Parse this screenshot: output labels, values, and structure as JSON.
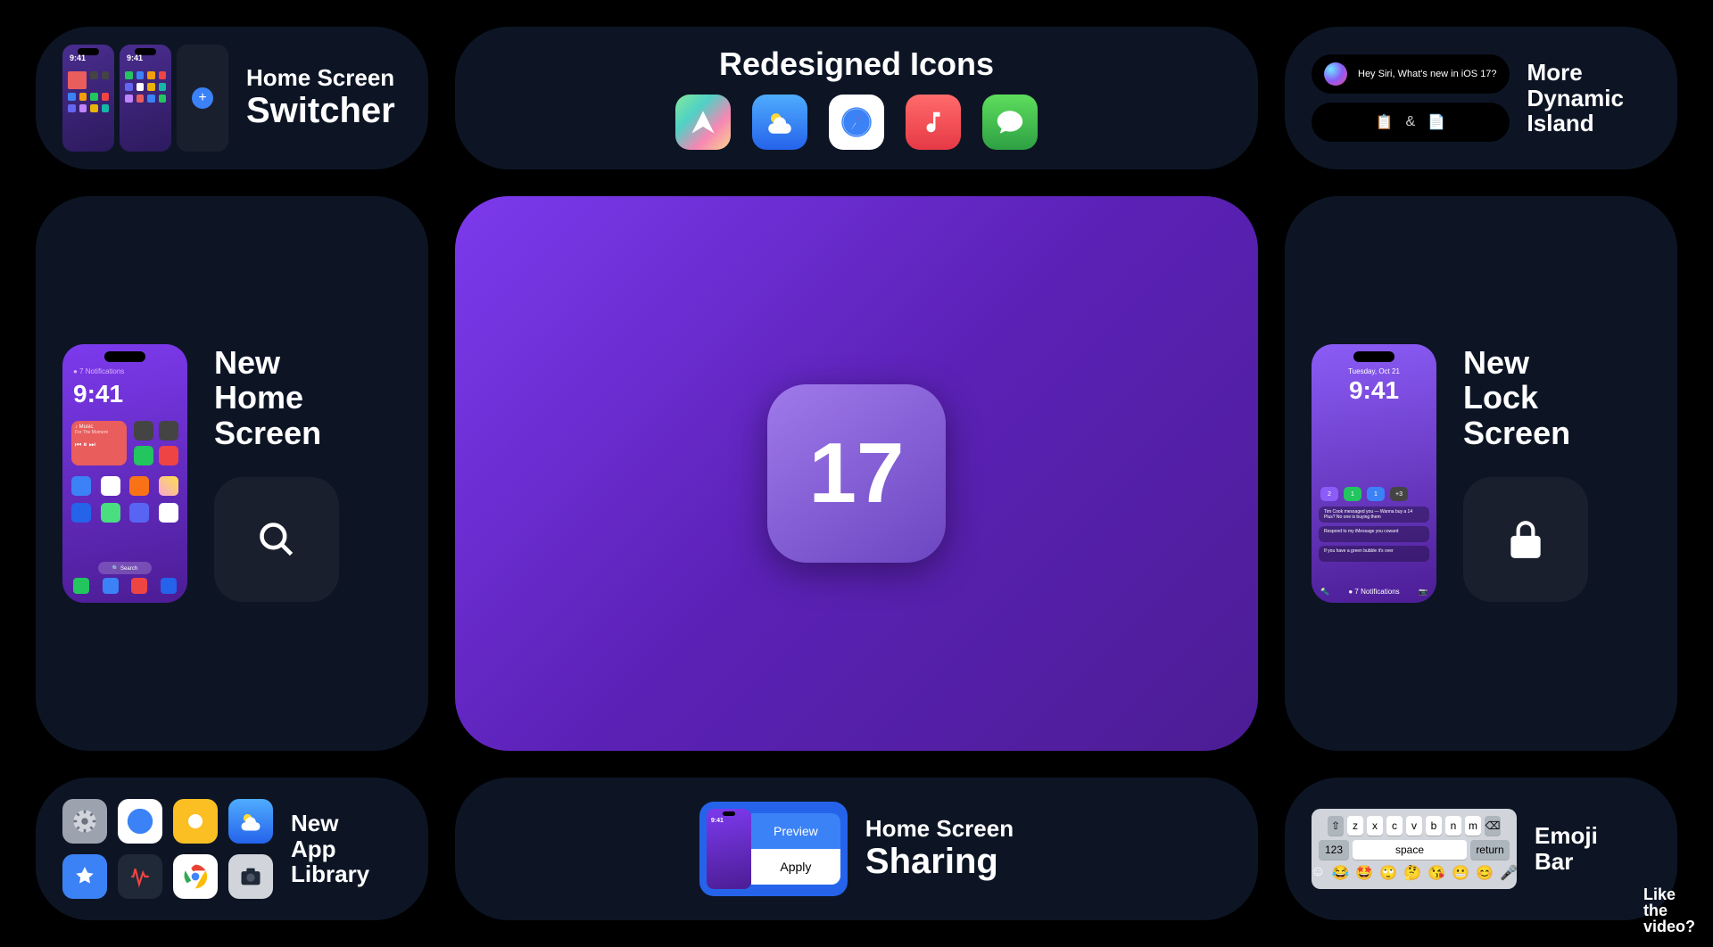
{
  "cards": {
    "homeSwitcher": {
      "line1": "Home Screen",
      "line2": "Switcher",
      "phoneTime": "9:41"
    },
    "redesignedIcons": {
      "title": "Redesigned Icons"
    },
    "dynamicIsland": {
      "line1": "More",
      "line2": "Dynamic",
      "line3": "Island",
      "siriText": "Hey Siri, What's new in iOS 17?",
      "amp": "&"
    },
    "newHome": {
      "line1": "New",
      "line2": "Home",
      "line3": "Screen",
      "phoneTime": "9:41",
      "notifText": "● 7 Notifications",
      "widgetTitle": "♪ Music",
      "widgetSubtitle": "For The Moment",
      "searchPill": "🔍 Search"
    },
    "hero": {
      "version": "17"
    },
    "newLock": {
      "line1": "New",
      "line2": "Lock",
      "line3": "Screen",
      "date": "Tuesday, Oct 21",
      "time": "9:41",
      "chipCounts": [
        "2",
        "1",
        "1",
        "+3"
      ],
      "notifs": [
        "Tim Cook messaged you — Wanna buy a 14 Plus? No one is buying them",
        "Respond to my iMessage you coward",
        "If you have a green bubble it's over"
      ],
      "bottomText": "● 7 Notifications"
    },
    "appLibrary": {
      "line1": "New",
      "line2": "App",
      "line3": "Library"
    },
    "homeSharing": {
      "line1": "Home Screen",
      "line2": "Sharing",
      "btnPreview": "Preview",
      "btnApply": "Apply",
      "miniTime": "9:41"
    },
    "emojiBar": {
      "line1": "Emoji",
      "line2": "Bar",
      "keys1": [
        "⇧",
        "z",
        "x",
        "c",
        "v",
        "b",
        "n",
        "m",
        "⌫"
      ],
      "keys2": [
        "123",
        "space",
        "return"
      ],
      "emojis": [
        "☺",
        "😂",
        "🤩",
        "🙄",
        "🤔",
        "😘",
        "😬",
        "😊",
        "🎤"
      ]
    }
  },
  "watermark": {
    "line1": "Like",
    "line2": "the",
    "line3": "video?"
  }
}
